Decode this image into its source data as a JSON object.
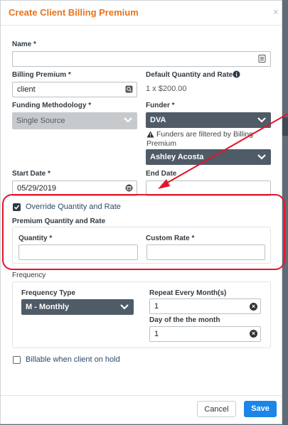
{
  "dialog": {
    "title": "Create Client Billing Premium",
    "close_symbol": "×"
  },
  "name": {
    "label": "Name *",
    "value": ""
  },
  "billing_premium": {
    "label": "Billing Premium *",
    "value": "client"
  },
  "default_qty_rate": {
    "label": "Default Quantity and Rate",
    "value": "1 x $200.00"
  },
  "funding_methodology": {
    "label": "Funding Methodology *",
    "value": "Single Source"
  },
  "funder": {
    "label": "Funder *",
    "value": "DVA",
    "warning": [
      "Funders are filtered by Billing",
      "Premium"
    ],
    "secondary_value": "Ashley Acosta"
  },
  "start_date": {
    "label": "Start Date *",
    "value": "05/29/2019"
  },
  "end_date": {
    "label": "End Date",
    "value": ""
  },
  "override": {
    "label": "Override Quantity and Rate",
    "checked": true
  },
  "premium_qty_rate": {
    "label": "Premium Quantity and Rate",
    "quantity_label": "Quantity *",
    "quantity_value": "",
    "custom_rate_label": "Custom Rate *",
    "custom_rate_value": ""
  },
  "frequency": {
    "label": "Frequency",
    "type_label": "Frequency Type",
    "type_value": "M - Monthly",
    "repeat_label": "Repeat Every Month(s)",
    "repeat_value": "1",
    "day_label": "Day of the the month",
    "day_value": "1"
  },
  "billable_on_hold": {
    "label": "Billable when client on hold",
    "checked": false
  },
  "footer": {
    "cancel_label": "Cancel",
    "save_label": "Save"
  },
  "colors": {
    "accent_title": "#e8731d",
    "primary_button": "#1b86e8",
    "dark_select": "#4f5b66",
    "annotation_red": "#e3152a"
  }
}
